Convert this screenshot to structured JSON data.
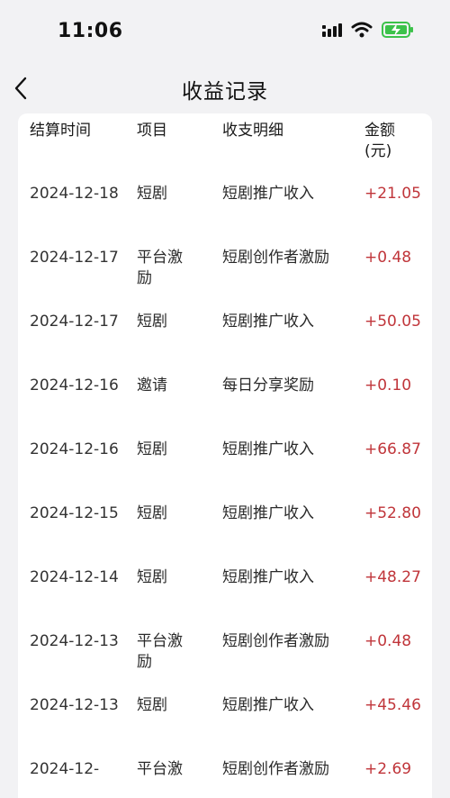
{
  "status_bar": {
    "time": "11:06"
  },
  "nav": {
    "title": "收益记录"
  },
  "table": {
    "headers": [
      "结算时间",
      "项目",
      "收支明细",
      "金额\n(元)"
    ],
    "rows": [
      {
        "date": "2024-12-18",
        "item": "短剧",
        "detail": "短剧推广收入",
        "amount": "+21.05"
      },
      {
        "date": "2024-12-17",
        "item": "平台激励",
        "detail": "短剧创作者激励",
        "amount": "+0.48"
      },
      {
        "date": "2024-12-17",
        "item": "短剧",
        "detail": "短剧推广收入",
        "amount": "+50.05"
      },
      {
        "date": "2024-12-16",
        "item": "邀请",
        "detail": "每日分享奖励",
        "amount": "+0.10"
      },
      {
        "date": "2024-12-16",
        "item": "短剧",
        "detail": "短剧推广收入",
        "amount": "+66.87"
      },
      {
        "date": "2024-12-15",
        "item": "短剧",
        "detail": "短剧推广收入",
        "amount": "+52.80"
      },
      {
        "date": "2024-12-14",
        "item": "短剧",
        "detail": "短剧推广收入",
        "amount": "+48.27"
      },
      {
        "date": "2024-12-13",
        "item": "平台激励",
        "detail": "短剧创作者激励",
        "amount": "+0.48"
      },
      {
        "date": "2024-12-13",
        "item": "短剧",
        "detail": "短剧推广收入",
        "amount": "+45.46"
      },
      {
        "date": "2024-12-",
        "item": "平台激",
        "detail": "短剧创作者激励",
        "amount": "+2.69"
      }
    ]
  },
  "colors": {
    "amount": "#c0353a",
    "background": "#f2f2f4",
    "battery": "#3cc24a"
  }
}
